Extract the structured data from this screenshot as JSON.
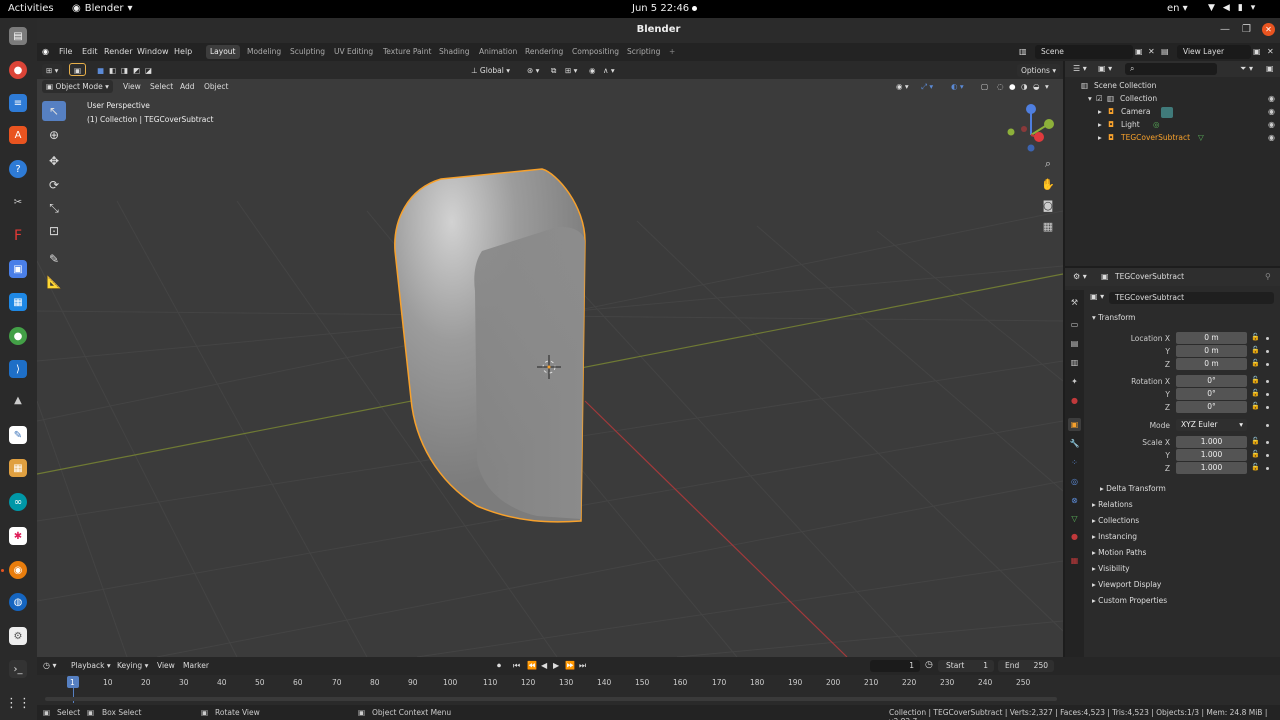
{
  "system": {
    "activities": "Activities",
    "app_name": "Blender",
    "clock": "Jun 5  22:46",
    "language": "en"
  },
  "window": {
    "title": "Blender"
  },
  "blender": {
    "menus": [
      "File",
      "Edit",
      "Render",
      "Window",
      "Help"
    ],
    "workspaces": [
      "Layout",
      "Modeling",
      "Sculpting",
      "UV Editing",
      "Texture Paint",
      "Shading",
      "Animation",
      "Rendering",
      "Compositing",
      "Scripting"
    ],
    "active_workspace": "Layout",
    "scene": "Scene",
    "view_layer": "View Layer"
  },
  "viewport": {
    "mode": "Object Mode",
    "menus": [
      "View",
      "Select",
      "Add",
      "Object"
    ],
    "orientation": "Global",
    "options": "Options",
    "perspective_label": "User Perspective",
    "collection_label": "(1) Collection | TEGCoverSubtract"
  },
  "outliner": {
    "search_placeholder": "",
    "items": [
      {
        "label": "Scene Collection"
      },
      {
        "label": "Collection"
      },
      {
        "label": "Camera"
      },
      {
        "label": "Light"
      },
      {
        "label": "TEGCoverSubtract"
      }
    ]
  },
  "properties": {
    "object_name": "TEGCoverSubtract",
    "object_field": "TEGCoverSubtract",
    "transform_title": "Transform",
    "location": {
      "label_x": "Location X",
      "label_y": "Y",
      "label_z": "Z",
      "x": "0 m",
      "y": "0 m",
      "z": "0 m"
    },
    "rotation": {
      "label_x": "Rotation X",
      "label_y": "Y",
      "label_z": "Z",
      "x": "0°",
      "y": "0°",
      "z": "0°"
    },
    "mode": {
      "label": "Mode",
      "value": "XYZ Euler"
    },
    "scale": {
      "label_x": "Scale X",
      "label_y": "Y",
      "label_z": "Z",
      "x": "1.000",
      "y": "1.000",
      "z": "1.000"
    },
    "delta_transform": "Delta Transform",
    "panels": [
      "Relations",
      "Collections",
      "Instancing",
      "Motion Paths",
      "Visibility",
      "Viewport Display",
      "Custom Properties"
    ]
  },
  "timeline": {
    "menus": [
      "Playback",
      "Keying",
      "View",
      "Marker"
    ],
    "current_frame": "1",
    "start_label": "Start",
    "start": "1",
    "end_label": "End",
    "end": "250",
    "ticks": [
      "1",
      "10",
      "20",
      "30",
      "40",
      "50",
      "60",
      "70",
      "80",
      "90",
      "100",
      "110",
      "120",
      "130",
      "140",
      "150",
      "160",
      "170",
      "180",
      "190",
      "200",
      "210",
      "220",
      "230",
      "240",
      "250"
    ]
  },
  "statusbar": {
    "select": "Select",
    "box_select": "Box Select",
    "rotate_view": "Rotate View",
    "context_menu": "Object Context Menu",
    "stats": "Collection | TEGCoverSubtract | Verts:2,327 | Faces:4,523 | Tris:4,523 | Objects:1/3 | Mem: 24.8 MiB | v2.82.7"
  },
  "colors": {
    "accent": "#5680c2",
    "selection": "#f7a12c",
    "ubuntu_orange": "#e95420",
    "x_axis": "#c0393b",
    "y_axis": "#8db03a"
  }
}
